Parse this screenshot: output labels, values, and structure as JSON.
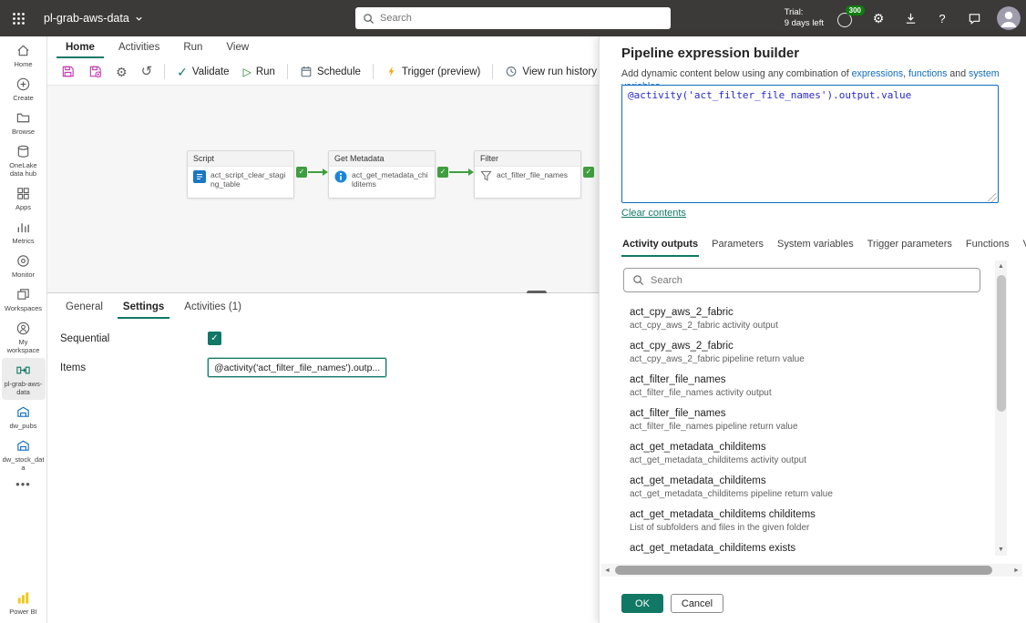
{
  "topbar": {
    "workspace_name": "pl-grab-aws-data",
    "search_placeholder": "Search",
    "trial_line1": "Trial:",
    "trial_line2": "9 days left",
    "badge_count": "300"
  },
  "ribbon_tabs": [
    {
      "label": "Home"
    },
    {
      "label": "Activities"
    },
    {
      "label": "Run"
    },
    {
      "label": "View"
    }
  ],
  "toolbar": {
    "validate_label": "Validate",
    "run_label": "Run",
    "schedule_label": "Schedule",
    "trigger_label": "Trigger (preview)",
    "history_label": "View run history"
  },
  "sidebar": {
    "items": [
      {
        "label": "Home"
      },
      {
        "label": "Create"
      },
      {
        "label": "Browse"
      },
      {
        "label": "OneLake data hub"
      },
      {
        "label": "Apps"
      },
      {
        "label": "Metrics"
      },
      {
        "label": "Monitor"
      },
      {
        "label": "Workspaces"
      },
      {
        "label": "My workspace"
      },
      {
        "label": "pl-grab-aws-data"
      },
      {
        "label": "dw_pubs"
      },
      {
        "label": "dw_stock_data"
      },
      {
        "label": "Power BI"
      }
    ]
  },
  "canvas": {
    "activities": [
      {
        "type": "Script",
        "name": "act_script_clear_staging_table"
      },
      {
        "type": "Get Metadata",
        "name": "act_get_metadata_childitems"
      },
      {
        "type": "Filter",
        "name": "act_filter_file_names"
      }
    ]
  },
  "config_panel": {
    "tabs": [
      {
        "label": "General"
      },
      {
        "label": "Settings"
      },
      {
        "label": "Activities (1)"
      }
    ],
    "sequential_label": "Sequential",
    "items_label": "Items",
    "items_value": "@activity('act_filter_file_names').outp..."
  },
  "expression_builder": {
    "title": "Pipeline expression builder",
    "intro_text": "Add dynamic content below using any combination of ",
    "intro_link_expressions": "expressions",
    "intro_sep1": ", ",
    "intro_link_functions": "functions",
    "intro_sep2": " and ",
    "intro_link_system_variables": "system variables",
    "intro_end": ".",
    "expression": "@activity('act_filter_file_names').output.value",
    "clear_contents_label": "Clear contents",
    "tabs": [
      {
        "label": "Activity outputs"
      },
      {
        "label": "Parameters"
      },
      {
        "label": "System variables"
      },
      {
        "label": "Trigger parameters"
      },
      {
        "label": "Functions"
      },
      {
        "label": "V"
      }
    ],
    "search_placeholder": "Search",
    "results": [
      {
        "title": "act_cpy_aws_2_fabric",
        "subtitle": "act_cpy_aws_2_fabric activity output"
      },
      {
        "title": "act_cpy_aws_2_fabric",
        "subtitle": "act_cpy_aws_2_fabric pipeline return value"
      },
      {
        "title": "act_filter_file_names",
        "subtitle": "act_filter_file_names activity output"
      },
      {
        "title": "act_filter_file_names",
        "subtitle": "act_filter_file_names pipeline return value"
      },
      {
        "title": "act_get_metadata_childitems",
        "subtitle": "act_get_metadata_childitems activity output"
      },
      {
        "title": "act_get_metadata_childitems",
        "subtitle": "act_get_metadata_childitems pipeline return value"
      },
      {
        "title": "act_get_metadata_childitems childitems",
        "subtitle": "List of subfolders and files in the given folder"
      },
      {
        "title": "act_get_metadata_childitems exists",
        "subtitle": ""
      }
    ],
    "ok_label": "OK",
    "cancel_label": "Cancel"
  }
}
